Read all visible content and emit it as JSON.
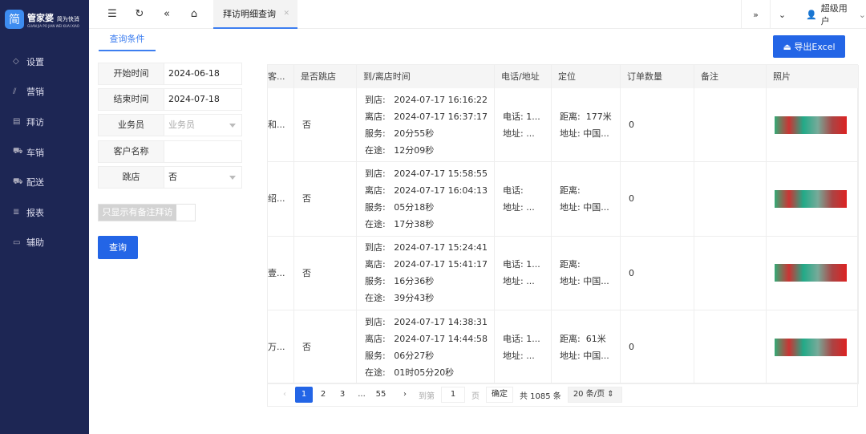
{
  "brand": {
    "name": "管家婆",
    "slogan": "简为快消",
    "sub": "GUAN JIA PO JIAN WEI KUAI XIAO"
  },
  "sidebar": {
    "items": [
      {
        "label": "设置",
        "icon": "tag-icon"
      },
      {
        "label": "营销",
        "icon": "chart-icon"
      },
      {
        "label": "拜访",
        "icon": "visit-icon"
      },
      {
        "label": "车销",
        "icon": "truck-icon"
      },
      {
        "label": "配送",
        "icon": "delivery-icon"
      },
      {
        "label": "报表",
        "icon": "report-icon"
      },
      {
        "label": "辅助",
        "icon": "monitor-icon"
      }
    ]
  },
  "topbar": {
    "tab": "拜访明细查询",
    "user": "超级用户"
  },
  "subtab": "查询条件",
  "export_label": "导出Excel",
  "form": {
    "start_label": "开始时间",
    "start": "2024-06-18",
    "end_label": "结束时间",
    "end": "2024-07-18",
    "staff_label": "业务员",
    "staff_placeholder": "业务员",
    "customer_label": "客户名称",
    "customer": "",
    "skip_label": "跳店",
    "skip": "否",
    "toggle_label": "只显示有备注拜访",
    "query_label": "查询"
  },
  "table": {
    "columns": [
      "客...",
      "是否跳店",
      "到/离店时间",
      "电话/地址",
      "定位",
      "订单数量",
      "备注",
      "照片"
    ],
    "rows": [
      {
        "customer": "和...",
        "skip": "否",
        "arrive": "到店:   2024-07-17 16:16:22",
        "leave": "离店:   2024-07-17 16:37:17",
        "service": "服务:   20分55秒",
        "transit": "在途:   12分09秒",
        "phone": "电话: 1...",
        "addr": "地址: ...",
        "dist": "距离:  177米",
        "loc": "地址: 中国...",
        "orders": "0",
        "note": ""
      },
      {
        "customer": "绍...",
        "skip": "否",
        "arrive": "到店:   2024-07-17 15:58:55",
        "leave": "离店:   2024-07-17 16:04:13",
        "service": "服务:   05分18秒",
        "transit": "在途:   17分38秒",
        "phone": "电话:",
        "addr": "地址: ...",
        "dist": "距离:",
        "loc": "地址: 中国...",
        "orders": "0",
        "note": ""
      },
      {
        "customer": "壹...",
        "skip": "否",
        "arrive": "到店:   2024-07-17 15:24:41",
        "leave": "离店:   2024-07-17 15:41:17",
        "service": "服务:   16分36秒",
        "transit": "在途:   39分43秒",
        "phone": "电话: 1...",
        "addr": "地址: ...",
        "dist": "距离:",
        "loc": "地址: 中国...",
        "orders": "0",
        "note": ""
      },
      {
        "customer": "万...",
        "skip": "否",
        "arrive": "到店:   2024-07-17 14:38:31",
        "leave": "离店:   2024-07-17 14:44:58",
        "service": "服务:   06分27秒",
        "transit": "在途:   01时05分20秒",
        "phone": "电话: 1...",
        "addr": "地址: ...",
        "dist": "距离:  61米",
        "loc": "地址: 中国...",
        "orders": "0",
        "note": ""
      }
    ]
  },
  "pager": {
    "pages": [
      "1",
      "2",
      "3",
      "...",
      "55"
    ],
    "current": "1",
    "goto_label": "到第",
    "goto_value": "1",
    "page_unit": "页",
    "confirm": "确定",
    "total": "共 1085 条",
    "page_size": "20 条/页"
  },
  "colors": {
    "sidebar": "#1d2654",
    "accent": "#2365e6"
  }
}
